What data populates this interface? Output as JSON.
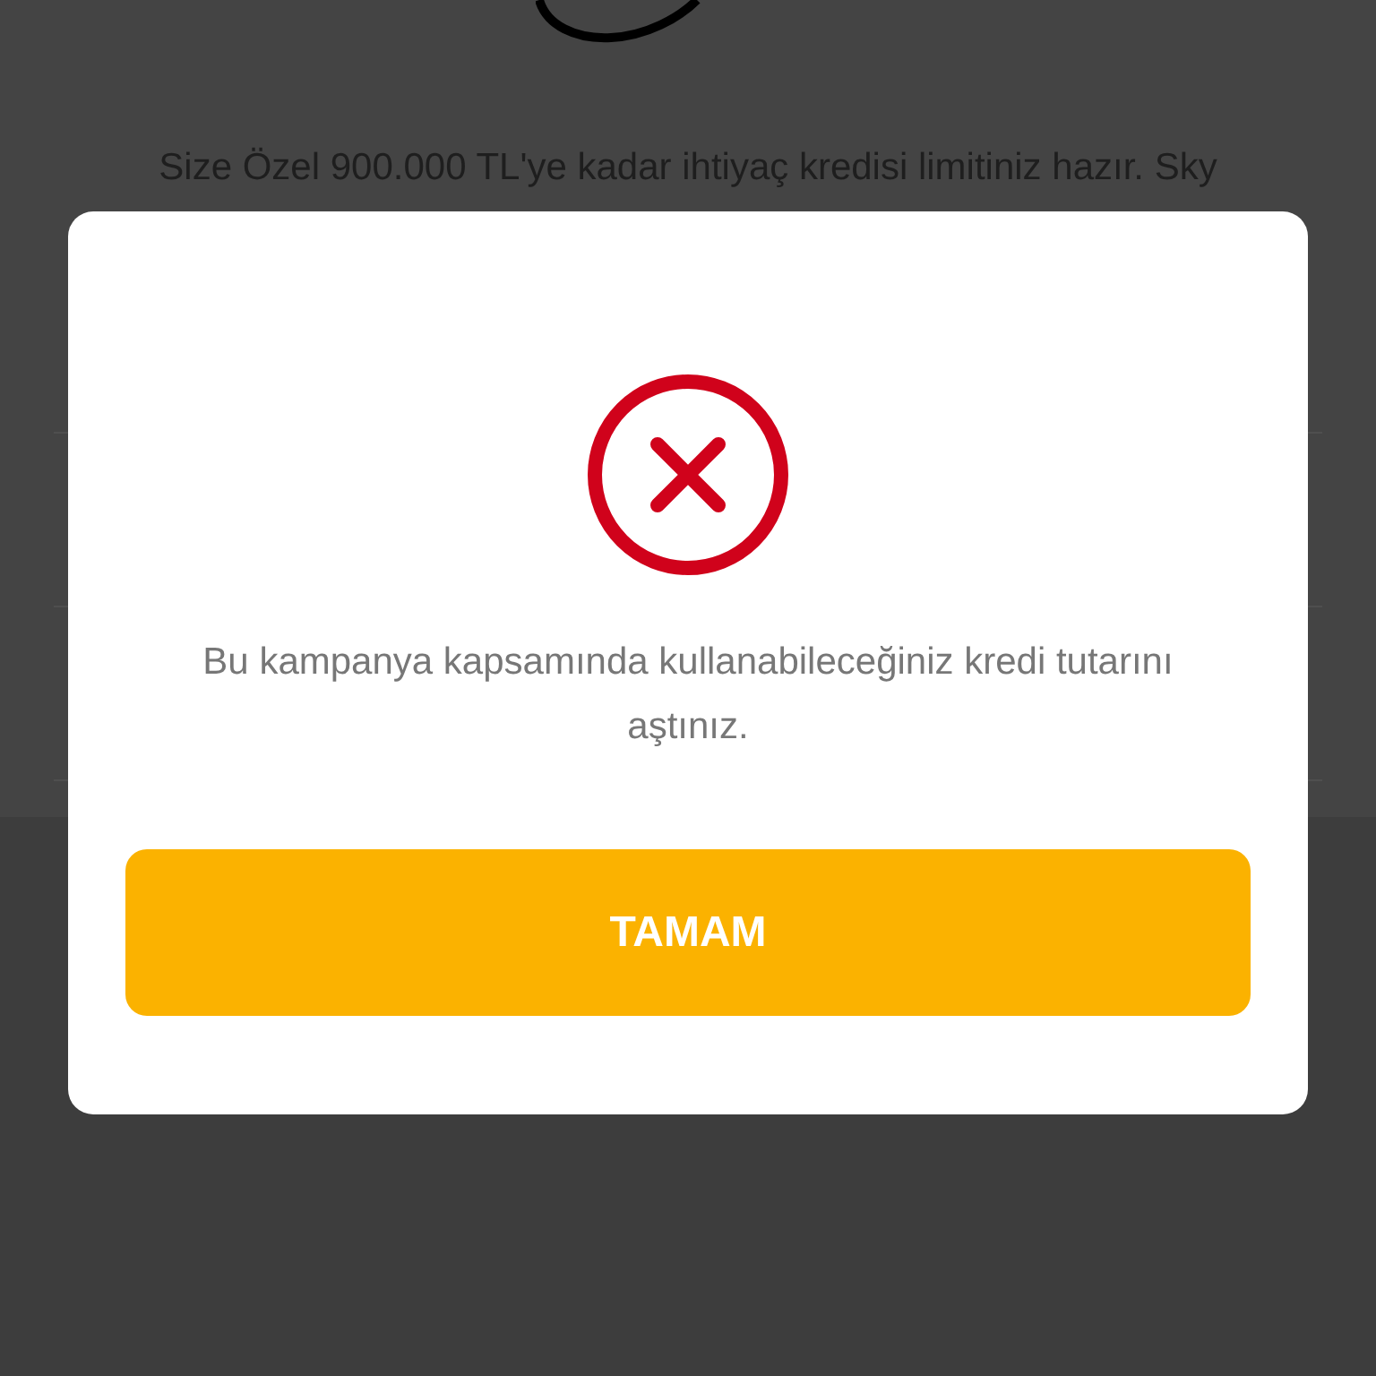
{
  "page": {
    "intro_text": "Size Özel 900.000 TL'ye kadar ihtiyaç kredisi limitiniz hazır. Sky"
  },
  "dialog": {
    "kind": "error",
    "message": "Bu kampanya kapsamında kullanabileceğiniz kredi tutarını aştınız.",
    "button": "TAMAM"
  }
}
